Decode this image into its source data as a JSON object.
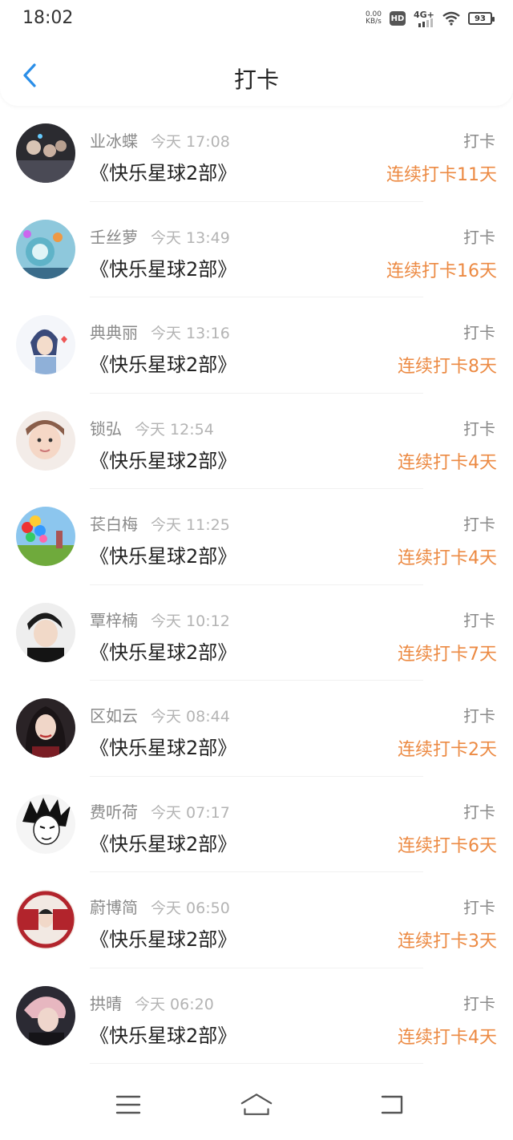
{
  "status_bar": {
    "time": "18:02",
    "speed_value": "0.00",
    "speed_unit": "KB/s",
    "hd": "HD",
    "network": "4G+",
    "battery": "93",
    "icons": [
      "hd-icon",
      "signal-icon",
      "wifi-icon",
      "battery-icon"
    ]
  },
  "header": {
    "title": "打卡",
    "back_icon": "chevron-left-icon",
    "accent": "#2a8ee8"
  },
  "colors": {
    "streak": "#ec8a43",
    "muted": "#8a8a8a"
  },
  "checkins": [
    {
      "name": "业冰蝶",
      "time": "今天 17:08",
      "program": "《快乐星球2部》",
      "action": "打卡",
      "streak": "连续打卡11天"
    },
    {
      "name": "壬丝萝",
      "time": "今天 13:49",
      "program": "《快乐星球2部》",
      "action": "打卡",
      "streak": "连续打卡16天"
    },
    {
      "name": "典典丽",
      "time": "今天 13:16",
      "program": "《快乐星球2部》",
      "action": "打卡",
      "streak": "连续打卡8天"
    },
    {
      "name": "锁弘",
      "time": "今天 12:54",
      "program": "《快乐星球2部》",
      "action": "打卡",
      "streak": "连续打卡4天"
    },
    {
      "name": "苌白梅",
      "time": "今天 11:25",
      "program": "《快乐星球2部》",
      "action": "打卡",
      "streak": "连续打卡4天"
    },
    {
      "name": "覃梓楠",
      "time": "今天 10:12",
      "program": "《快乐星球2部》",
      "action": "打卡",
      "streak": "连续打卡7天"
    },
    {
      "name": "区如云",
      "time": "今天 08:44",
      "program": "《快乐星球2部》",
      "action": "打卡",
      "streak": "连续打卡2天"
    },
    {
      "name": "费听荷",
      "time": "今天 07:17",
      "program": "《快乐星球2部》",
      "action": "打卡",
      "streak": "连续打卡6天"
    },
    {
      "name": "蔚博简",
      "time": "今天 06:50",
      "program": "《快乐星球2部》",
      "action": "打卡",
      "streak": "连续打卡3天"
    },
    {
      "name": "拱晴",
      "time": "今天 06:20",
      "program": "《快乐星球2部》",
      "action": "打卡",
      "streak": "连续打卡4天"
    }
  ],
  "bottom_nav": {
    "icons": [
      "menu-icon",
      "home-icon",
      "back-icon"
    ]
  }
}
